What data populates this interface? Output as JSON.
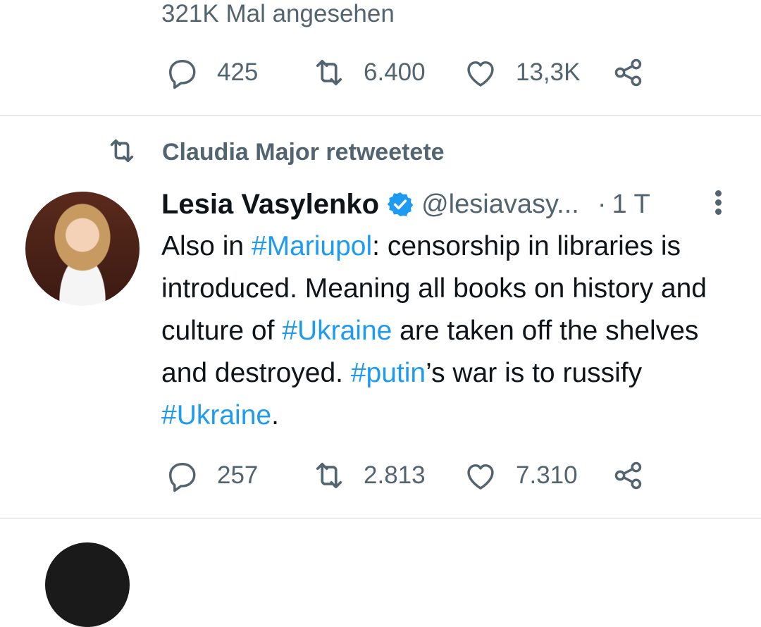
{
  "prev_tweet": {
    "views_text": "321K Mal angesehen",
    "replies": "425",
    "retweets": "6.400",
    "likes": "13,3K"
  },
  "retweet_banner": "Claudia Major retweetete",
  "tweet": {
    "author_name": "Lesia Vasylenko",
    "verified": true,
    "handle": "@lesiavasy...",
    "separator": "·",
    "time": "1 T",
    "text_parts": [
      {
        "t": "Also in ",
        "tag": false
      },
      {
        "t": "#Mariupol",
        "tag": true
      },
      {
        "t": ": censorship in libraries is introduced. Meaning all books on history and culture of ",
        "tag": false
      },
      {
        "t": "#Ukraine",
        "tag": true
      },
      {
        "t": " are taken off the shelves and destroyed. ",
        "tag": false
      },
      {
        "t": "#putin",
        "tag": true
      },
      {
        "t": "’s war is to russify ",
        "tag": false
      },
      {
        "t": "#Ukraine",
        "tag": true
      },
      {
        "t": ".",
        "tag": false
      }
    ],
    "replies": "257",
    "retweets": "2.813",
    "likes": "7.310"
  },
  "colors": {
    "link": "#1d9bf0",
    "muted": "#536471",
    "text": "#0f1419",
    "divider": "#dadada"
  },
  "icons": [
    "reply-icon",
    "retweet-icon",
    "like-icon",
    "share-icon",
    "verified-badge-icon",
    "more-options-icon"
  ]
}
